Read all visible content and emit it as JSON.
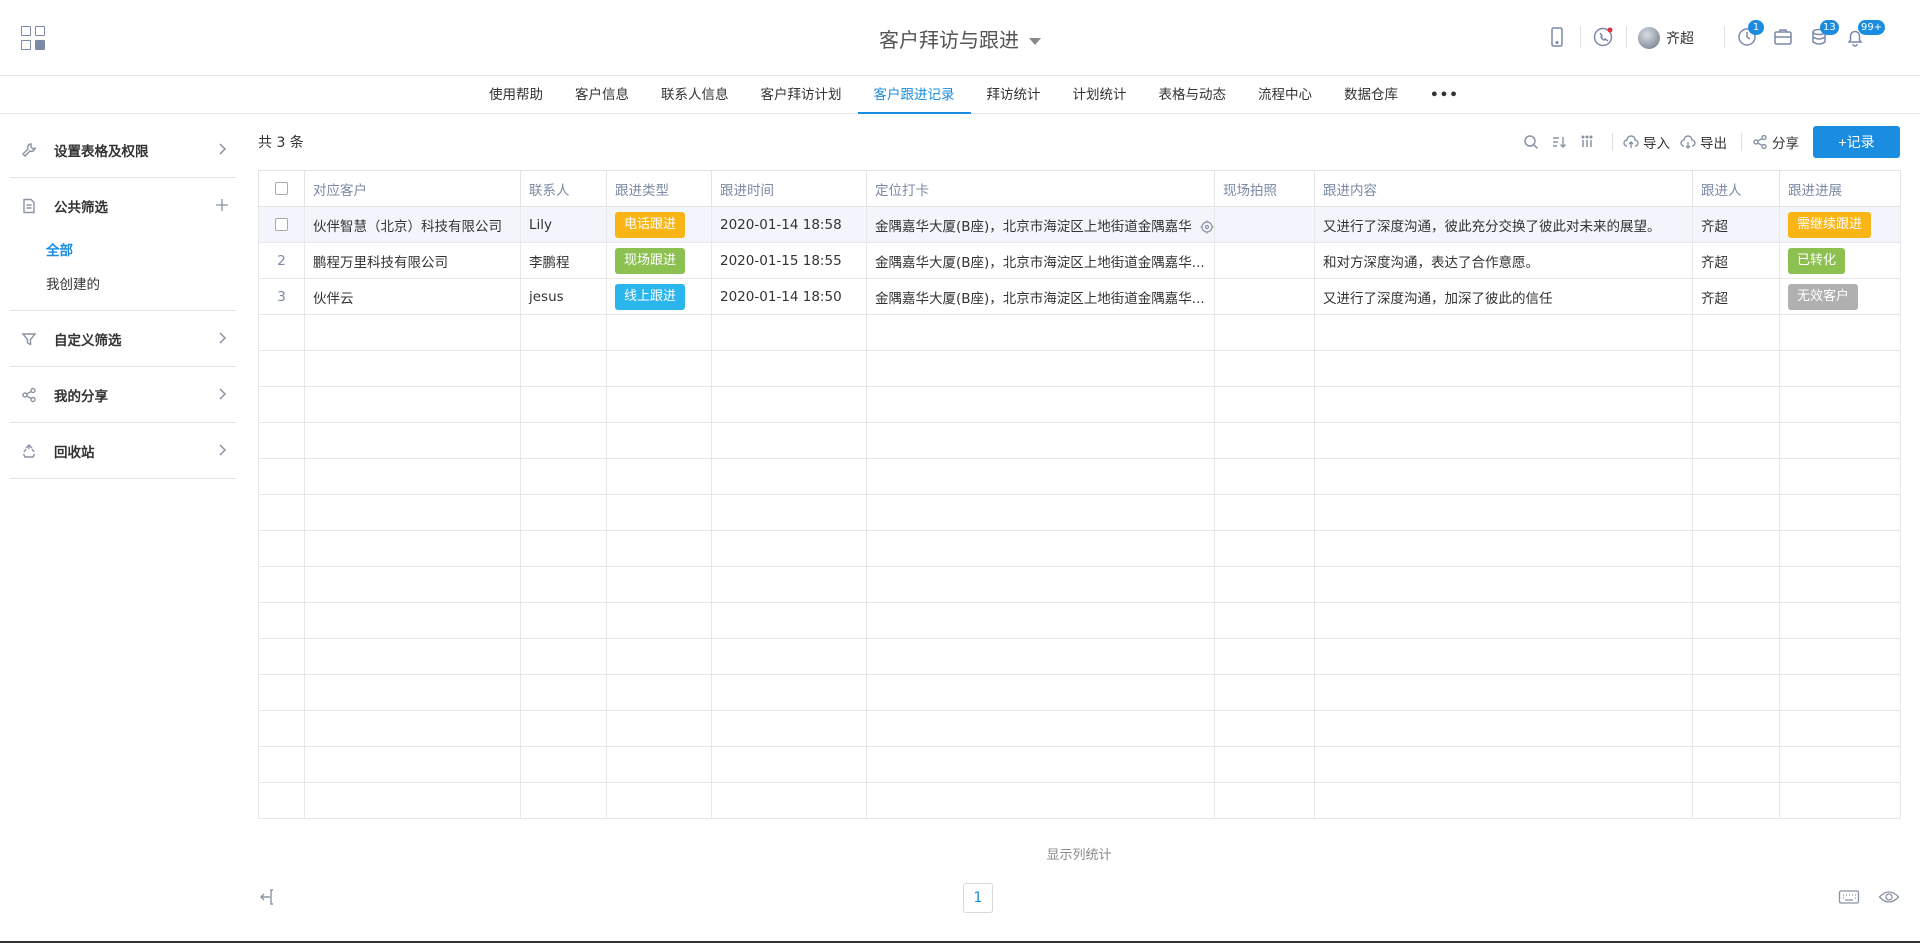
{
  "header": {
    "title": "客户拜访与跟进",
    "user_name": "齐超",
    "badges": {
      "clock": "1",
      "stack": "13",
      "bell": "99+"
    }
  },
  "nav": [
    "使用帮助",
    "客户信息",
    "联系人信息",
    "客户拜访计划",
    "客户跟进记录",
    "拜访统计",
    "计划统计",
    "表格与动态",
    "流程中心",
    "数据仓库"
  ],
  "nav_active_index": 4,
  "sidebar": {
    "settings": "设置表格及权限",
    "public_filter": "公共筛选",
    "sub_all": "全部",
    "sub_mine": "我创建的",
    "custom_filter": "自定义筛选",
    "my_share": "我的分享",
    "recycle": "回收站"
  },
  "main": {
    "count": "共 3 条",
    "toolbar": {
      "import": "导入",
      "export": "导出",
      "share": "分享",
      "add": "+记录"
    },
    "footer_stat": "显示列统计",
    "page": "1"
  },
  "table": {
    "columns": [
      "对应客户",
      "联系人",
      "跟进类型",
      "跟进时间",
      "定位打卡",
      "现场拍照",
      "跟进内容",
      "跟进人",
      "跟进进展"
    ],
    "rows": [
      {
        "customer": "伙伴智慧（北京）科技有限公司",
        "contact": "Lily",
        "type": "电话跟进",
        "type_color": "#f9b515",
        "time": "2020-01-14 18:58",
        "location": "金隅嘉华大厦(B座)，北京市海淀区上地街道金隅嘉华",
        "photo": "",
        "content": "又进行了深度沟通，彼此充分交换了彼此对未来的展望。",
        "owner": "齐超",
        "progress": "需继续跟进",
        "progress_color": "#f9b515"
      },
      {
        "customer": "鹏程万里科技有限公司",
        "contact": "李鹏程",
        "type": "现场跟进",
        "type_color": "#8cc152",
        "time": "2020-01-15 18:55",
        "location": "金隅嘉华大厦(B座)，北京市海淀区上地街道金隅嘉华...",
        "photo": "",
        "content": "和对方深度沟通，表达了合作意愿。",
        "owner": "齐超",
        "progress": "已转化",
        "progress_color": "#8cc152"
      },
      {
        "customer": "伙伴云",
        "contact": "jesus",
        "type": "线上跟进",
        "type_color": "#2bb5ed",
        "time": "2020-01-14 18:50",
        "location": "金隅嘉华大厦(B座)，北京市海淀区上地街道金隅嘉华...",
        "photo": "",
        "content": "又进行了深度沟通，加深了彼此的信任",
        "owner": "齐超",
        "progress": "无效客户",
        "progress_color": "#b0b0b0"
      }
    ],
    "row_numbers": [
      "2",
      "3"
    ],
    "empty_rows": 14
  },
  "colors": {
    "accent": "#1a8de0",
    "header_text": "#7c8aa5",
    "row_highlight": "#f2f5fb"
  }
}
